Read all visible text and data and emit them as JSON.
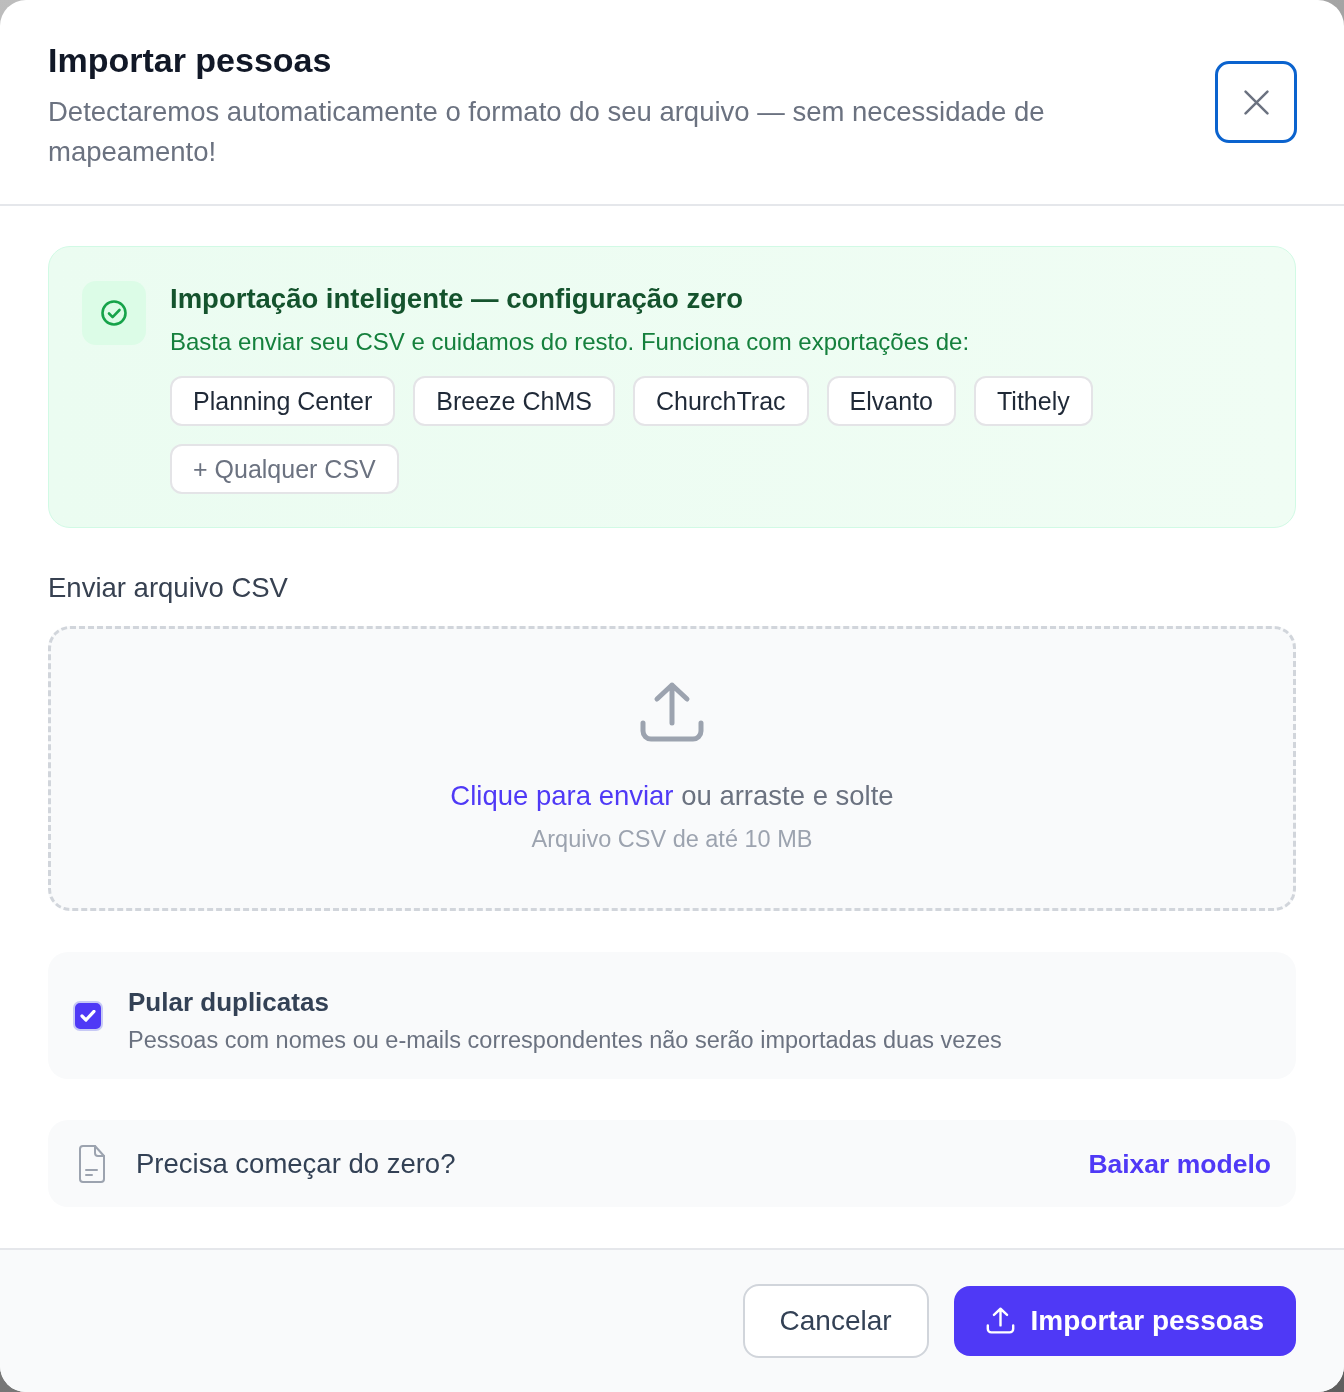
{
  "dialog": {
    "title": "Importar pessoas",
    "subtitle": "Detectaremos automaticamente o formato do seu arquivo — sem necessidade de mapeamento!",
    "close_button": {
      "focused": true
    }
  },
  "smart_import": {
    "title": "Importação inteligente — configuração zero",
    "description": "Basta enviar seu CSV e cuidamos do resto. Funciona com exportações de:",
    "sources": [
      {
        "label": "Planning Center",
        "kind": "platform"
      },
      {
        "label": "Breeze ChMS",
        "kind": "platform"
      },
      {
        "label": "ChurchTrac",
        "kind": "platform"
      },
      {
        "label": "Elvanto",
        "kind": "platform"
      },
      {
        "label": "Tithely",
        "kind": "platform"
      },
      {
        "label": "+ Qualquer CSV",
        "kind": "any"
      }
    ]
  },
  "upload": {
    "label": "Enviar arquivo CSV",
    "link": "Clique para enviar",
    "prompt": "ou arraste e solte",
    "hint": "Arquivo CSV de até 10 MB"
  },
  "skip_duplicates": {
    "title": "Pular duplicatas",
    "description": "Pessoas com nomes ou e-mails correspondentes não serão importadas duas vezes",
    "checked": true
  },
  "template": {
    "question": "Precisa começar do zero?",
    "link": "Baixar modelo"
  },
  "footer": {
    "buttons": [
      {
        "label": "Cancelar",
        "kind": "secondary"
      },
      {
        "label": "Importar pessoas",
        "kind": "primary"
      }
    ]
  }
}
